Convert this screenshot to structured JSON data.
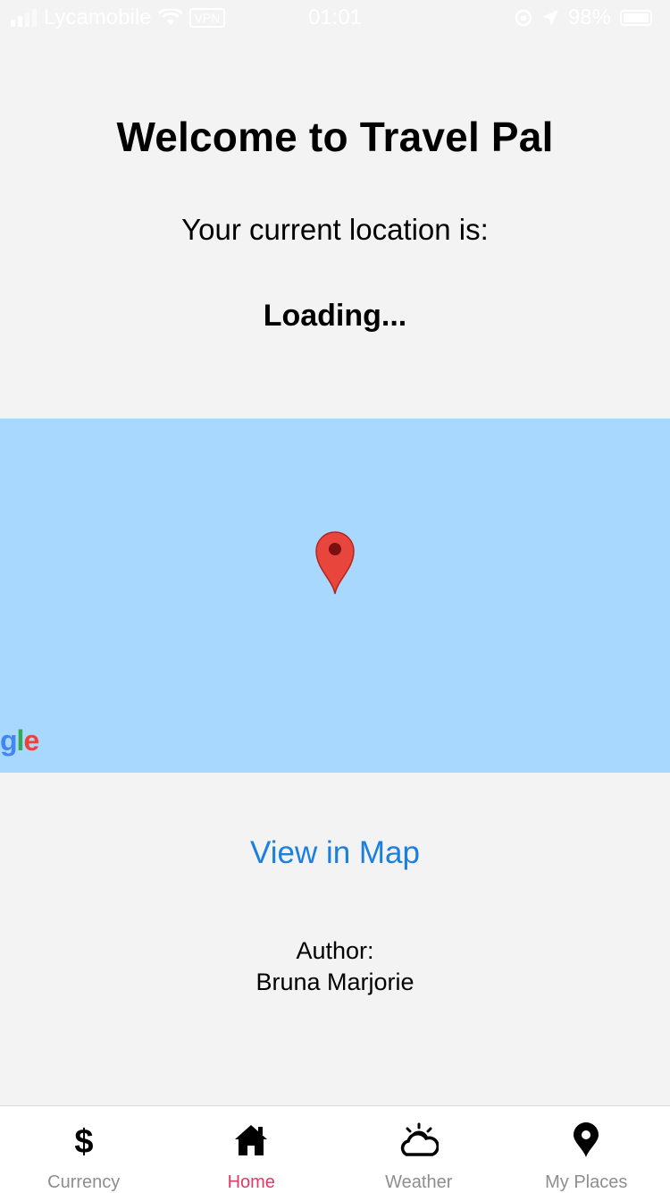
{
  "status_bar": {
    "carrier": "Lycamobile",
    "vpn": "VPN",
    "time": "01:01",
    "battery": "98%"
  },
  "header": {
    "title": "Welcome to Travel Pal",
    "subtitle": "Your current location is:",
    "location": "Loading..."
  },
  "map": {
    "pin_icon": "map-pin-icon",
    "logo": {
      "g": "g",
      "l": "l",
      "e": "e"
    },
    "water_color": "#a9d8fe"
  },
  "actions": {
    "view_map": "View in Map"
  },
  "author": {
    "label": "Author:",
    "name": "Bruna Marjorie"
  },
  "tabs": [
    {
      "label": "Currency",
      "icon": "dollar-icon",
      "active": false
    },
    {
      "label": "Home",
      "icon": "home-icon",
      "active": true
    },
    {
      "label": "Weather",
      "icon": "weather-icon",
      "active": false
    },
    {
      "label": "My Places",
      "icon": "place-pin-icon",
      "active": false
    }
  ],
  "colors": {
    "accent": "#e33a63",
    "link": "#1a7fe0",
    "background": "#f3f3f3"
  }
}
